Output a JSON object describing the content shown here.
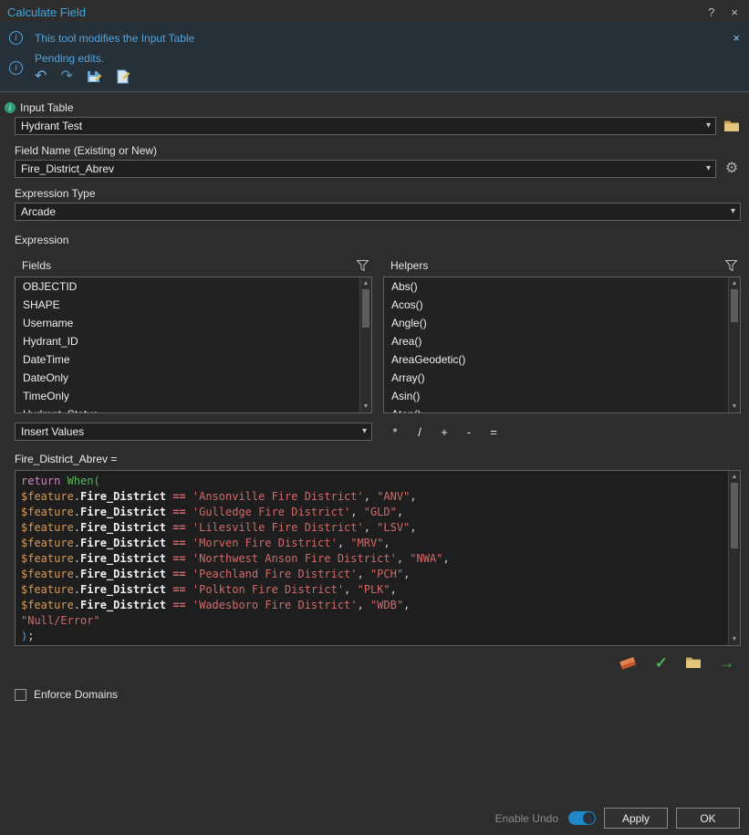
{
  "window": {
    "title": "Calculate Field"
  },
  "icons": {
    "info": "i",
    "help": "?",
    "close": "×",
    "undo": "↶",
    "redo": "↷",
    "chevron": "▾",
    "check": "✓",
    "arrow_right": "→",
    "scroll_up": "▲",
    "scroll_down": "▼",
    "gear": "⚙"
  },
  "banner": {
    "message": "This tool modifies the Input Table",
    "pending_message": "Pending edits."
  },
  "form": {
    "input_table_label": "Input Table",
    "input_table_value": "Hydrant Test",
    "field_name_label": "Field Name (Existing or New)",
    "field_name_value": "Fire_District_Abrev",
    "expression_type_label": "Expression Type",
    "expression_type_value": "Arcade",
    "expression_section_label": "Expression"
  },
  "fields_panel": {
    "label": "Fields",
    "items": [
      "OBJECTID",
      "SHAPE",
      "Username",
      "Hydrant_ID",
      "DateTime",
      "DateOnly",
      "TimeOnly",
      "Hydrant_Status"
    ]
  },
  "helpers_panel": {
    "label": "Helpers",
    "items": [
      "Abs()",
      "Acos()",
      "Angle()",
      "Area()",
      "AreaGeodetic()",
      "Array()",
      "Asin()",
      "Atan()"
    ]
  },
  "insert_values_label": "Insert Values",
  "operators": [
    "*",
    "/",
    "+",
    "-",
    "="
  ],
  "expression_heading": "Fire_District_Abrev =",
  "code": {
    "colors": {
      "keyword": "#c586c0",
      "function": "#5bb75b",
      "variable": "#d69a5a",
      "field": "#f0f0f0",
      "operator": "#d16969",
      "string": "#d16969",
      "plain": "#d4d4d4",
      "paren": "#569cd6"
    },
    "lines": [
      [
        [
          "keyword",
          "return"
        ],
        [
          "plain",
          " "
        ],
        [
          "function",
          "When("
        ]
      ],
      [
        [
          "variable",
          "$feature"
        ],
        [
          "plain",
          "."
        ],
        [
          "field",
          "Fire_District"
        ],
        [
          "plain",
          " "
        ],
        [
          "operator",
          "=="
        ],
        [
          "plain",
          " "
        ],
        [
          "string",
          "'Ansonville Fire District'"
        ],
        [
          "plain",
          ", "
        ],
        [
          "string",
          "\"ANV\""
        ],
        [
          "plain",
          ","
        ]
      ],
      [
        [
          "variable",
          "$feature"
        ],
        [
          "plain",
          "."
        ],
        [
          "field",
          "Fire_District"
        ],
        [
          "plain",
          " "
        ],
        [
          "operator",
          "=="
        ],
        [
          "plain",
          " "
        ],
        [
          "string",
          "'Gulledge Fire District'"
        ],
        [
          "plain",
          ", "
        ],
        [
          "string",
          "\"GLD\""
        ],
        [
          "plain",
          ","
        ]
      ],
      [
        [
          "variable",
          "$feature"
        ],
        [
          "plain",
          "."
        ],
        [
          "field",
          "Fire_District"
        ],
        [
          "plain",
          " "
        ],
        [
          "operator",
          "=="
        ],
        [
          "plain",
          " "
        ],
        [
          "string",
          "'Lilesville Fire District'"
        ],
        [
          "plain",
          ", "
        ],
        [
          "string",
          "\"LSV\""
        ],
        [
          "plain",
          ","
        ]
      ],
      [
        [
          "variable",
          "$feature"
        ],
        [
          "plain",
          "."
        ],
        [
          "field",
          "Fire_District"
        ],
        [
          "plain",
          " "
        ],
        [
          "operator",
          "=="
        ],
        [
          "plain",
          " "
        ],
        [
          "string",
          "'Morven Fire District'"
        ],
        [
          "plain",
          ", "
        ],
        [
          "string",
          "\"MRV\""
        ],
        [
          "plain",
          ","
        ]
      ],
      [
        [
          "variable",
          "$feature"
        ],
        [
          "plain",
          "."
        ],
        [
          "field",
          "Fire_District"
        ],
        [
          "plain",
          " "
        ],
        [
          "operator",
          "=="
        ],
        [
          "plain",
          " "
        ],
        [
          "string",
          "'Northwest Anson Fire District'"
        ],
        [
          "plain",
          ", "
        ],
        [
          "string",
          "\"NWA\""
        ],
        [
          "plain",
          ","
        ]
      ],
      [
        [
          "variable",
          "$feature"
        ],
        [
          "plain",
          "."
        ],
        [
          "field",
          "Fire_District"
        ],
        [
          "plain",
          " "
        ],
        [
          "operator",
          "=="
        ],
        [
          "plain",
          " "
        ],
        [
          "string",
          "'Peachland Fire District'"
        ],
        [
          "plain",
          ", "
        ],
        [
          "string",
          "\"PCH\""
        ],
        [
          "plain",
          ","
        ]
      ],
      [
        [
          "variable",
          "$feature"
        ],
        [
          "plain",
          "."
        ],
        [
          "field",
          "Fire_District"
        ],
        [
          "plain",
          " "
        ],
        [
          "operator",
          "=="
        ],
        [
          "plain",
          " "
        ],
        [
          "string",
          "'Polkton Fire District'"
        ],
        [
          "plain",
          ", "
        ],
        [
          "string",
          "\"PLK\""
        ],
        [
          "plain",
          ","
        ]
      ],
      [
        [
          "variable",
          "$feature"
        ],
        [
          "plain",
          "."
        ],
        [
          "field",
          "Fire_District"
        ],
        [
          "plain",
          " "
        ],
        [
          "operator",
          "=="
        ],
        [
          "plain",
          " "
        ],
        [
          "string",
          "'Wadesboro Fire District'"
        ],
        [
          "plain",
          ", "
        ],
        [
          "string",
          "\"WDB\""
        ],
        [
          "plain",
          ","
        ]
      ],
      [
        [
          "string",
          "\"Null/Error\""
        ]
      ],
      [
        [
          "paren",
          ")"
        ],
        [
          "plain",
          ";"
        ]
      ]
    ]
  },
  "enforce_domains_label": "Enforce Domains",
  "footer": {
    "enable_undo_label": "Enable Undo",
    "apply_label": "Apply",
    "ok_label": "OK"
  }
}
